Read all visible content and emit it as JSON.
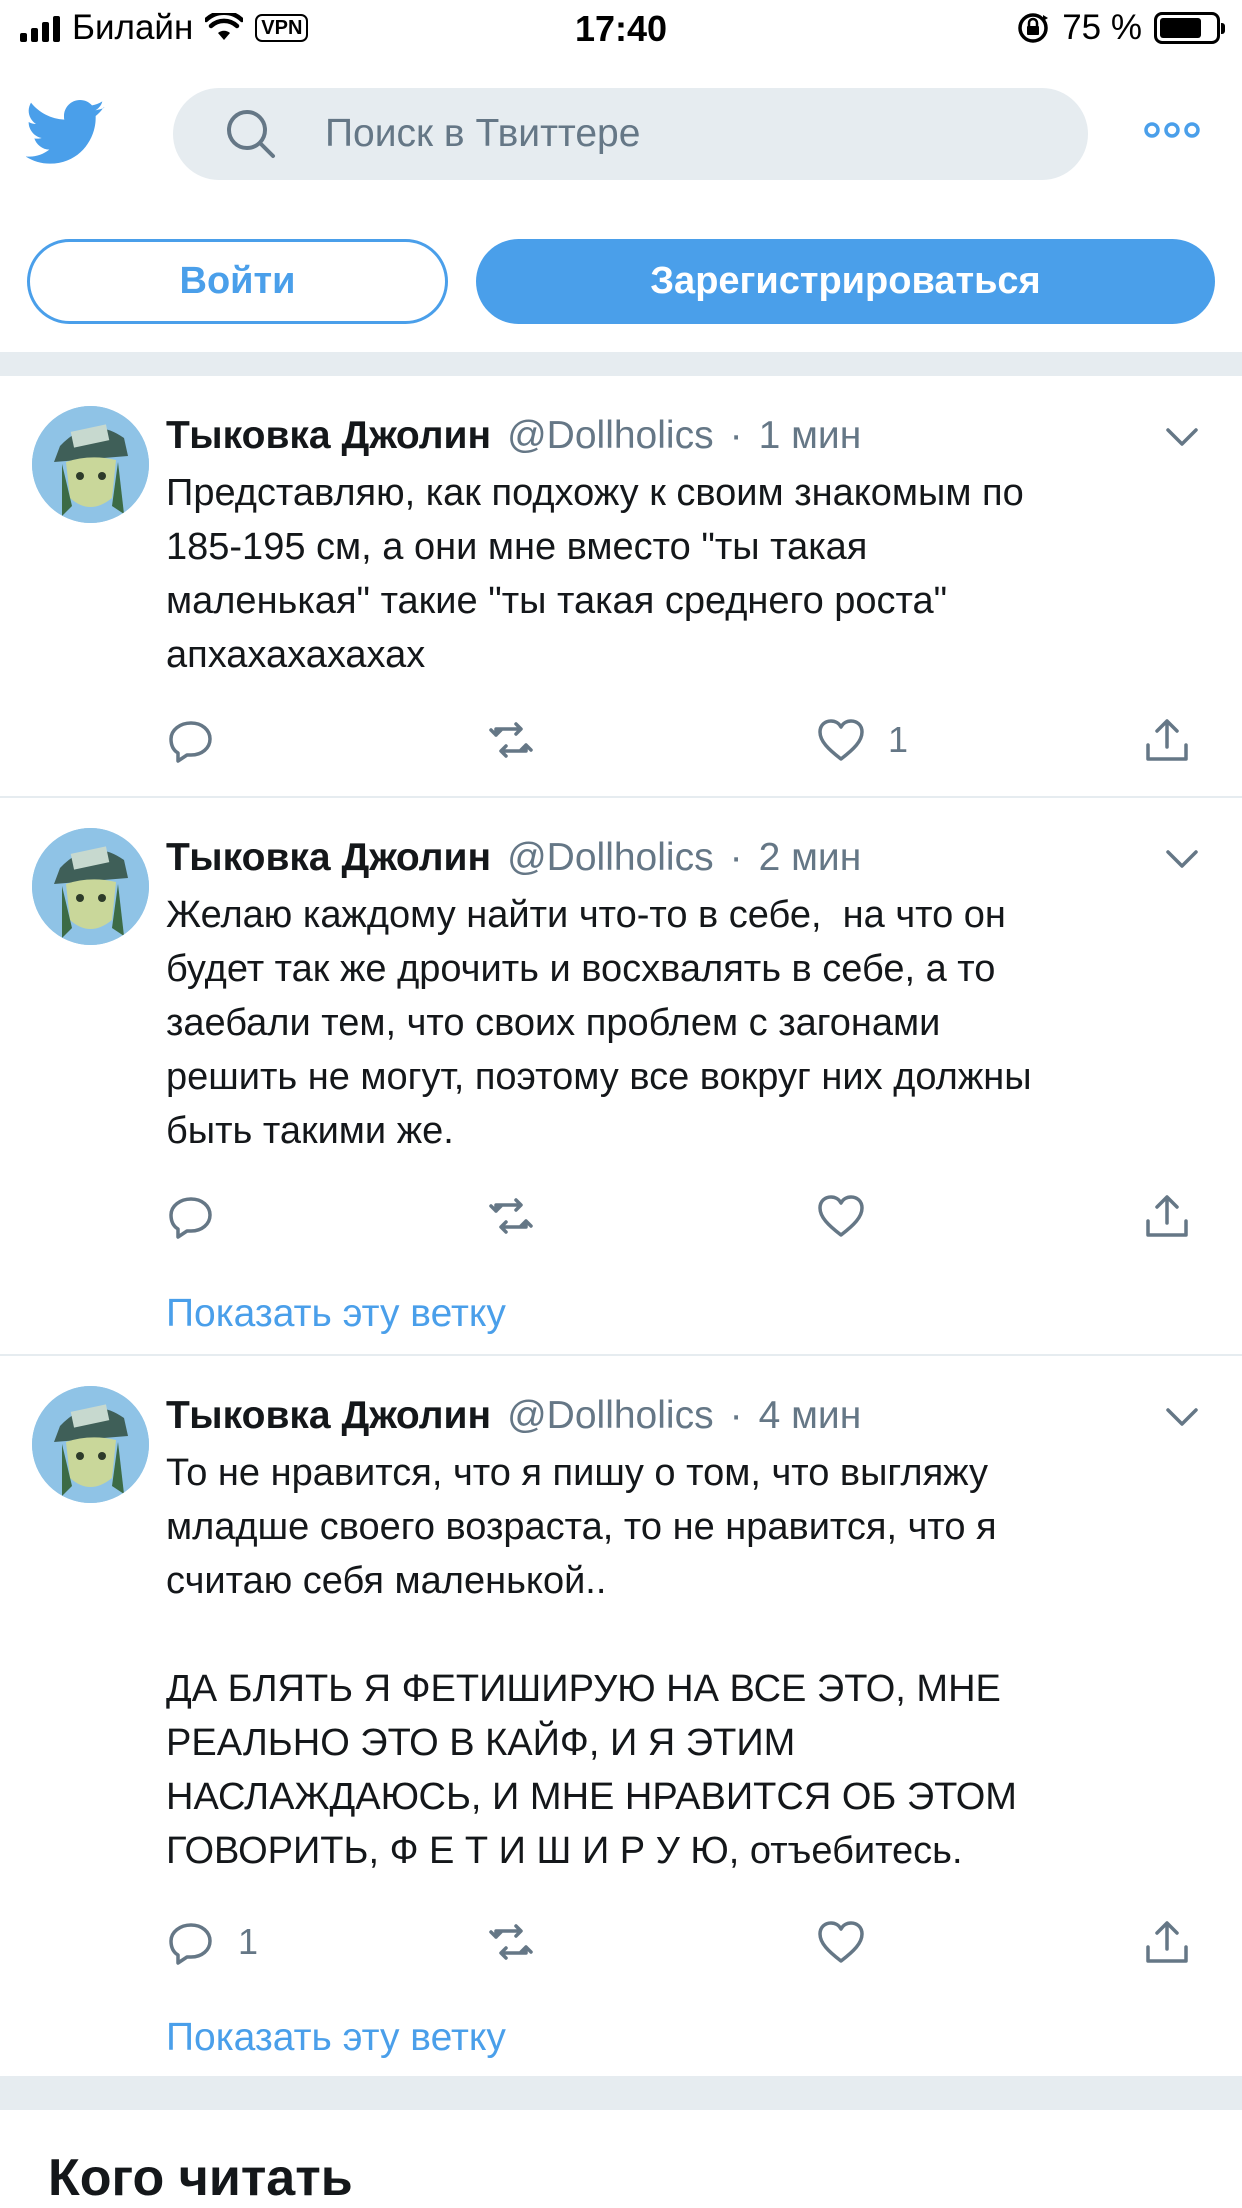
{
  "status_bar": {
    "carrier": "Билайн",
    "vpn": "VPN",
    "time": "17:40",
    "battery": "75 %",
    "battery_level": 0.75
  },
  "header": {
    "search_placeholder": "Поиск в Твиттере",
    "login_label": "Войти",
    "signup_label": "Зарегистрироваться"
  },
  "tweets": [
    {
      "name": "Тыковка Джолин",
      "handle": "@Dollholics",
      "sep": "·",
      "time": "1 мин",
      "text": "Представляю, как подхожу к своим знакомым по\n185-195 см, а они мне вместо \"ты такая\nмаленькая\" такие \"ты такая среднего роста\"\nапхахахахахах",
      "reply_count": "",
      "like_count": "1",
      "thread_link": ""
    },
    {
      "name": "Тыковка Джолин",
      "handle": "@Dollholics",
      "sep": "·",
      "time": "2 мин",
      "text": "Желаю каждому найти что-то в себе,  на что он\nбудет так же дрочить и восхвалять в себе, а то\nзаебали тем, что своих проблем с загонами\nрешить не могут, поэтому все вокруг них должны\nбыть такими же.",
      "reply_count": "",
      "like_count": "",
      "thread_link": "Показать эту ветку"
    },
    {
      "name": "Тыковка Джолин",
      "handle": "@Dollholics",
      "sep": "·",
      "time": "4 мин",
      "text": "То не нравится, что я пишу о том, что выгляжу\nмладше своего возраста, то не нравится, что я\nсчитаю себя маленькой..\n\nДА БЛЯТЬ Я ФЕТИШИРУЮ НА ВСЕ ЭТО, МНЕ\nРЕАЛЬНО ЭТО В КАЙФ, И Я ЭТИМ\nНАСЛАЖДАЮСЬ, И МНЕ НРАВИТСЯ ОБ ЭТОМ\nГОВОРИТЬ, Ф Е Т И Ш И Р У Ю, отъебитесь.",
      "reply_count": "1",
      "like_count": "",
      "thread_link": "Показать эту ветку"
    }
  ],
  "who_to_follow": {
    "title": "Кого читать"
  },
  "colors": {
    "accent": "#4a9fea",
    "muted_text": "#657786",
    "band": "#e6ecf0"
  }
}
